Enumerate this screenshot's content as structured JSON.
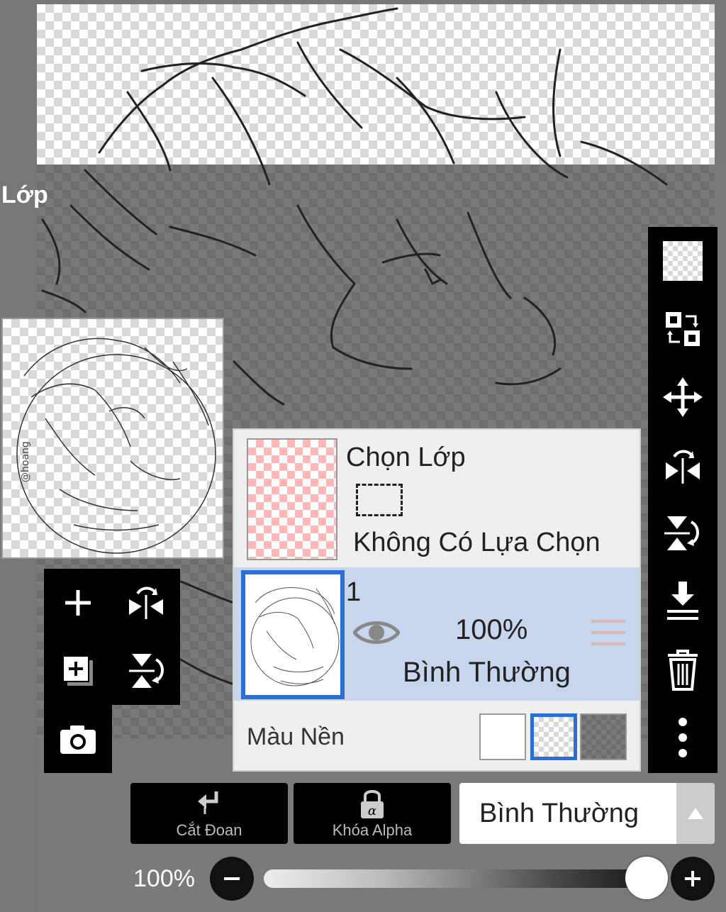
{
  "panel": {
    "title": "Lớp"
  },
  "left_tools": [
    {
      "name": "add-layer",
      "icon": "plus-icon"
    },
    {
      "name": "flip-horizontal",
      "icon": "flip-horizontal-icon"
    },
    {
      "name": "add-layer-copy",
      "icon": "add-copy-icon"
    },
    {
      "name": "flip-vertical",
      "icon": "flip-vertical-icon"
    },
    {
      "name": "camera",
      "icon": "camera-icon"
    }
  ],
  "right_tools": [
    {
      "name": "transparent-fill",
      "icon": "checkerboard-icon"
    },
    {
      "name": "swap-layers",
      "icon": "swap-icon"
    },
    {
      "name": "move",
      "icon": "move-arrows-icon"
    },
    {
      "name": "flip-horizontal",
      "icon": "flip-horizontal-icon"
    },
    {
      "name": "flip-vertical",
      "icon": "flip-vertical-icon"
    },
    {
      "name": "merge-down",
      "icon": "merge-down-icon"
    },
    {
      "name": "delete",
      "icon": "trash-icon"
    },
    {
      "name": "more",
      "icon": "more-vertical-icon"
    }
  ],
  "selection_layer": {
    "title": "Chọn Lớp",
    "status": "Không Có Lựa Chọn"
  },
  "layers": [
    {
      "number": "1",
      "visible": true,
      "opacity": "100%",
      "blend_mode": "Bình Thường"
    }
  ],
  "background": {
    "label": "Màu Nền",
    "options": [
      "white",
      "transparent",
      "dark"
    ],
    "selected": "transparent"
  },
  "buttons": {
    "clip": "Cắt Đoan",
    "alpha_lock": "Khóa Alpha"
  },
  "blend_mode_select": {
    "value": "Bình Thường"
  },
  "opacity_slider": {
    "label": "100%",
    "value": 1.0
  },
  "colors": {
    "accent": "#2b6fd6",
    "selected_row": "#c7d6ec",
    "toolbar": "#000000"
  }
}
